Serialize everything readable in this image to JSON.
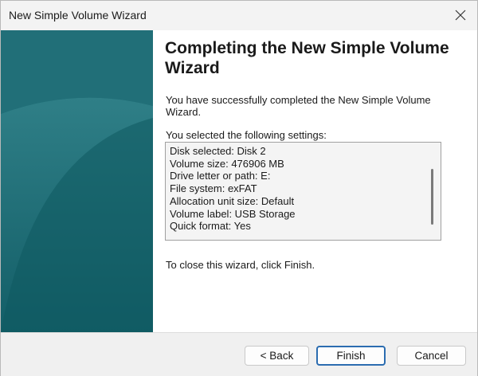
{
  "window": {
    "title": "New Simple Volume Wizard"
  },
  "wizard": {
    "heading": "Completing the New Simple Volume Wizard",
    "success_text": "You have successfully completed the New Simple Volume Wizard.",
    "settings_label": "You selected the following settings:",
    "settings": [
      "Disk selected: Disk 2",
      "Volume size: 476906 MB",
      "Drive letter or path: E:",
      "File system: exFAT",
      "Allocation unit size: Default",
      "Volume label: USB Storage",
      "Quick format: Yes"
    ],
    "close_text": "To close this wizard, click Finish."
  },
  "buttons": {
    "back": "< Back",
    "finish": "Finish",
    "cancel": "Cancel"
  },
  "icons": {
    "close": "close-icon"
  },
  "colors": {
    "panel": "#1e6d76",
    "panel_light": "#3f8b92",
    "accent": "#2b6cb0"
  }
}
